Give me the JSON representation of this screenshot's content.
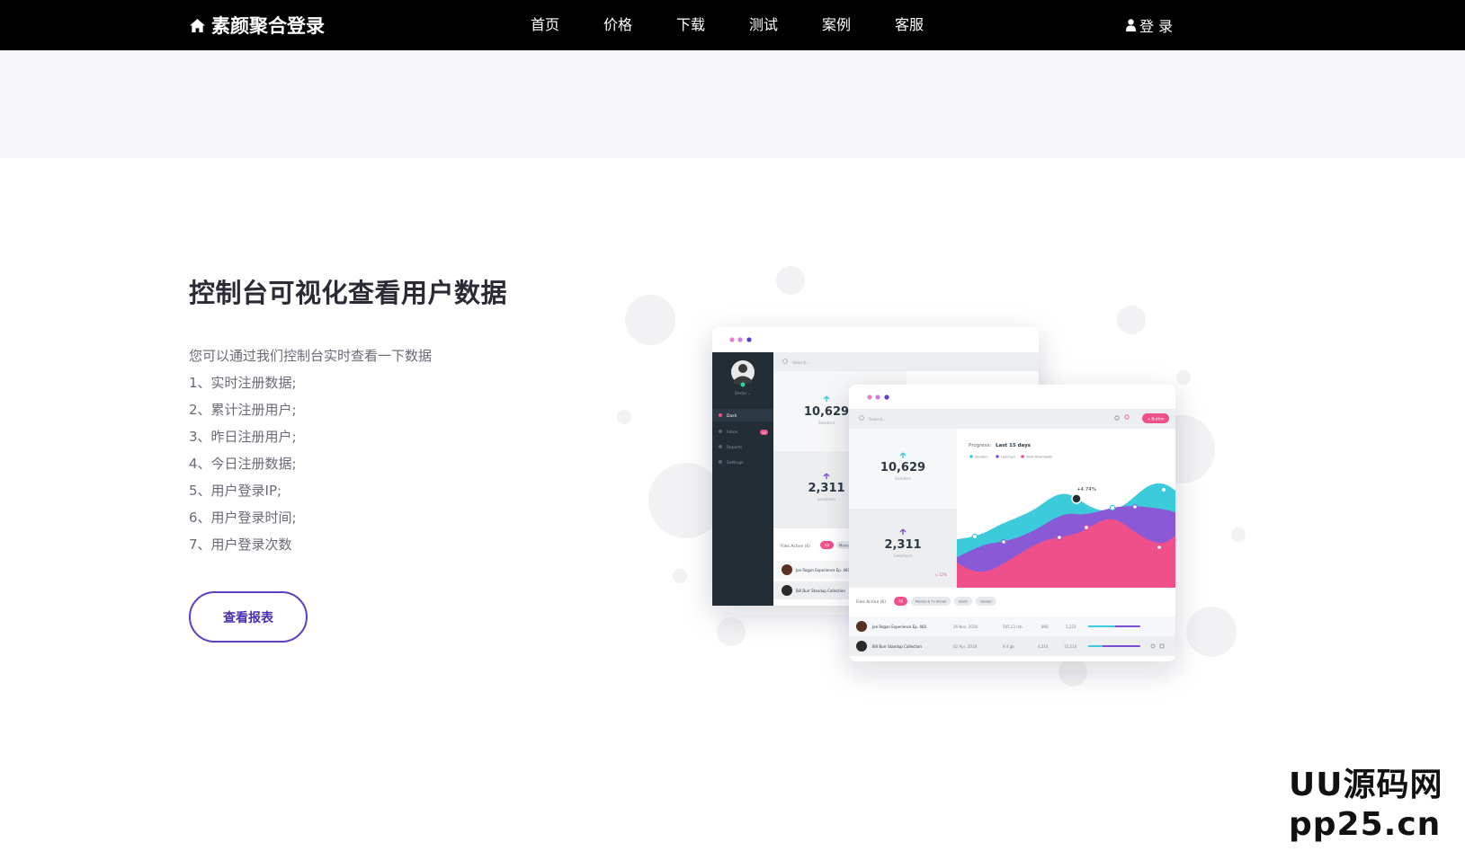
{
  "header": {
    "brand": "素颜聚合登录",
    "nav": [
      "首页",
      "价格",
      "下载",
      "测试",
      "案例",
      "客服"
    ],
    "login": "登 录"
  },
  "feature": {
    "title": "控制台可视化查看用户数据",
    "intro": "您可以通过我们控制台实时查看一下数据",
    "items": [
      "1、实时注册数据;",
      "2、累计注册用户;",
      "3、昨日注册用户;",
      "4、今日注册数据;",
      "5、用户登录IP;",
      "6、用户登录时间;",
      "7、用户登录次数"
    ],
    "button": "查看报表"
  },
  "mockup": {
    "back": {
      "search": "Search...",
      "menu": [
        "Dash",
        "Inbox",
        "Reports",
        "Settings"
      ],
      "inbox_badge": "10",
      "seeders_value": "10,629",
      "seeders_label": "Seeders",
      "leechers_value": "2,311",
      "leechers_label": "Leechers",
      "files_active": "Files Active (6)",
      "chip_all": "All",
      "chip_movies": "Movies",
      "rows": [
        "Joe Rogan Experience Ep. 460",
        "Bill Burr Standup Collection"
      ]
    },
    "front": {
      "search": "Search...",
      "button": "+ Button",
      "seeders_value": "10,629",
      "seeders_label": "Seeders",
      "leechers_value": "2,311",
      "leechers_label": "Leechers",
      "leechers_delta": "↘ 12%",
      "progress_prefix": "Progress:",
      "progress_label": "Last 15 days",
      "legend": [
        "Seeders",
        "Leechers",
        "Total Downloads"
      ],
      "peak": "+4.74%",
      "files_active": "Files Active (6)",
      "chips": [
        "All",
        "Movies & Tv Shows",
        "Sport",
        "Design"
      ],
      "rows": [
        {
          "name": "Joe Rogan Experience Ep. 460",
          "date": "26 Nov, 2018",
          "size": "565.23 mb",
          "up": "866",
          "down": "1,223"
        },
        {
          "name": "Bill Burr Standup Collection",
          "date": "02 Apr, 2018",
          "size": "9.4 gb",
          "up": "4,214",
          "down": "15,214"
        }
      ]
    },
    "colors": {
      "seeders": "#3ccbda",
      "leechers": "#7d4dd6",
      "downloads": "#f0508a",
      "dark_sidebar": "#222d36"
    }
  },
  "watermark": [
    "UU源码网",
    "pp25.cn"
  ]
}
